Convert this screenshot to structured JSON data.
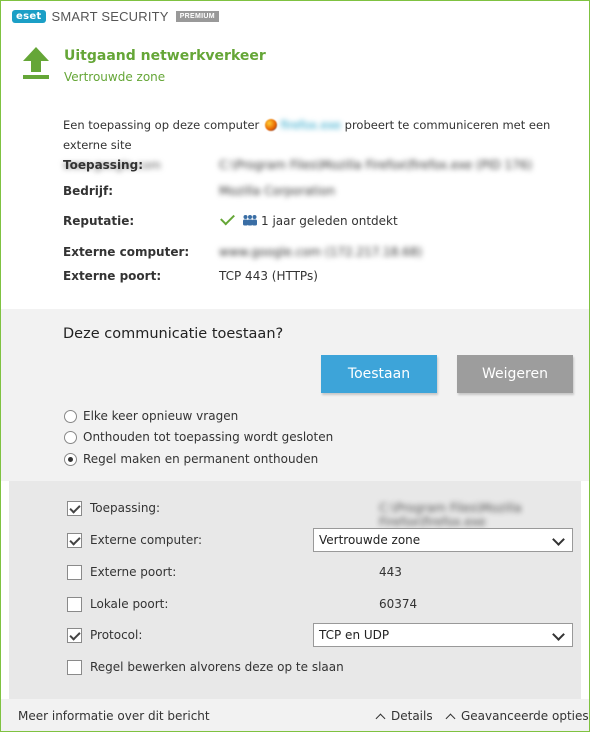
{
  "titlebar": {
    "logo": "eset",
    "app_name": "SMART SECURITY",
    "edition": "PREMIUM"
  },
  "header": {
    "icon": "arrow-up-icon",
    "title": "Uitgaand netwerkverkeer",
    "subtitle": "Vertrouwde zone"
  },
  "info": {
    "desc_before": "Een toepassing op deze computer",
    "app_link": "firefox.exe",
    "desc_after": "probeert te communiceren met een externe site",
    "remote_site": "www.google.com",
    "rows": [
      {
        "label": "Toepassing:",
        "value": "C:\\Program Files\\Mozilla Firefox\\firefox.exe (PID 176)"
      },
      {
        "label": "Bedrijf:",
        "value": "Mozilla Corporation"
      },
      {
        "label": "Reputatie:",
        "value": "1 jaar geleden ontdekt"
      },
      {
        "label": "Externe computer:",
        "value": "www.google.com (172.217.18.68)"
      },
      {
        "label": "Externe poort:",
        "value": "TCP 443 (HTTPs)"
      }
    ]
  },
  "question": {
    "title": "Deze communicatie toestaan?",
    "allow_label": "Toestaan",
    "deny_label": "Weigeren",
    "radios": [
      {
        "label": "Elke keer opnieuw vragen",
        "selected": false
      },
      {
        "label": "Onthouden tot toepassing wordt gesloten",
        "selected": false
      },
      {
        "label": "Regel maken en permanent onthouden",
        "selected": true
      }
    ]
  },
  "options": {
    "rows": [
      {
        "label": "Toepassing:",
        "checked": true,
        "value": "C:\\Program Files\\Mozilla Firefox\\firefox.exe"
      },
      {
        "label": "Externe computer:",
        "checked": true,
        "select": "Vertrouwde zone"
      },
      {
        "label": "Externe poort:",
        "checked": false,
        "value": "443"
      },
      {
        "label": "Lokale poort:",
        "checked": false,
        "value": "60374"
      },
      {
        "label": "Protocol:",
        "checked": true,
        "select": "TCP en UDP"
      },
      {
        "label": "Regel bewerken alvorens deze op te slaan",
        "checked": false
      }
    ]
  },
  "footer": {
    "more_info": "Meer informatie over dit bericht",
    "details": "Details",
    "advanced": "Geavanceerde opties"
  },
  "colors": {
    "accent_green": "#65a637",
    "allow_blue": "#3da4d9",
    "deny_grey": "#9d9d9d",
    "eset_blue": "#1b9fc6"
  }
}
